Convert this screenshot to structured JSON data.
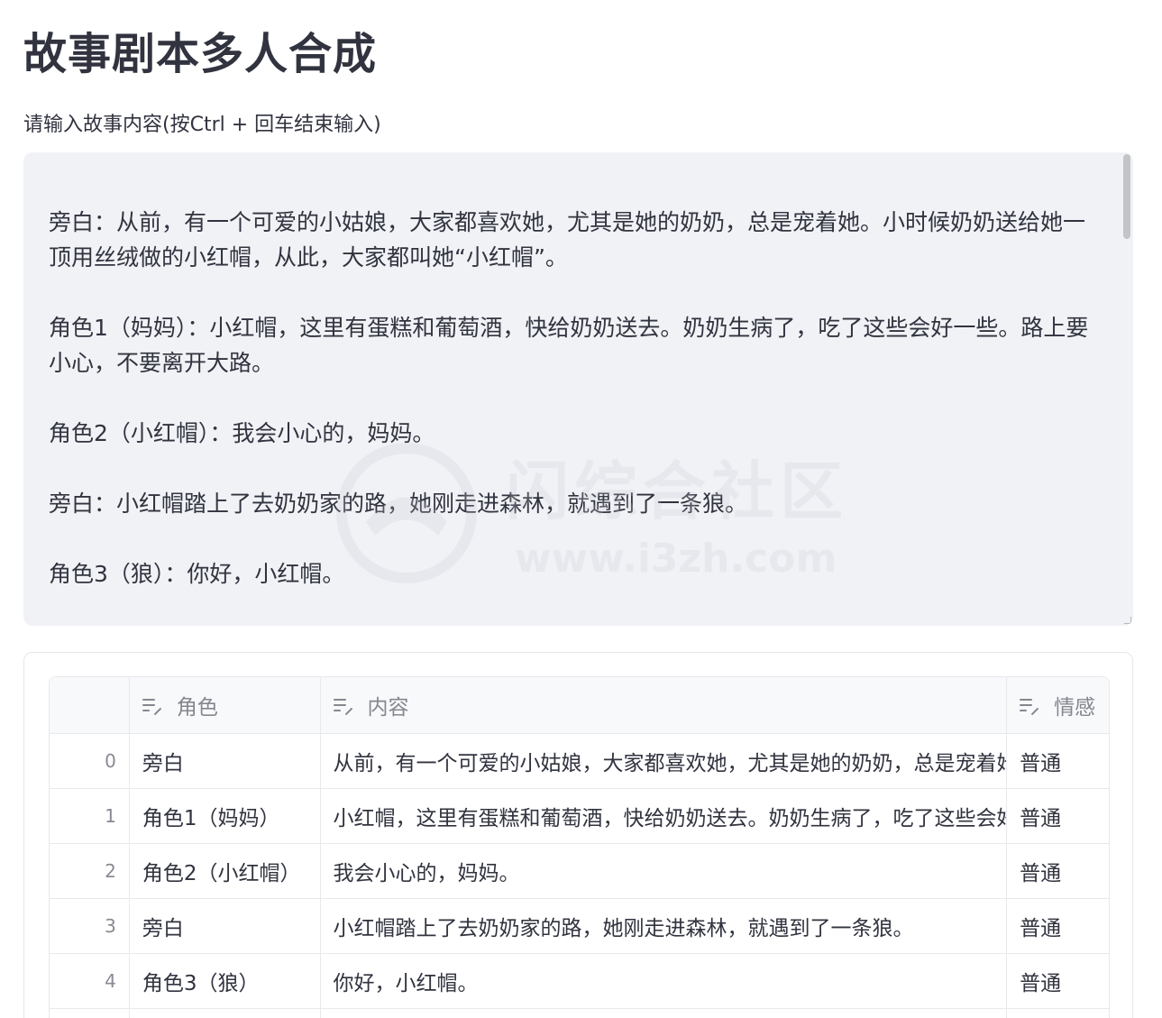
{
  "title": "故事剧本多人合成",
  "story_input": {
    "label": "请输入故事内容(按Ctrl + 回车结束输入)",
    "value": "旁白：从前，有一个可爱的小姑娘，大家都喜欢她，尤其是她的奶奶，总是宠着她。小时候奶奶送给她一顶用丝绒做的小红帽，从此，大家都叫她“小红帽”。\n\n角色1（妈妈）：小红帽，这里有蛋糕和葡萄酒，快给奶奶送去。奶奶生病了，吃了这些会好一些。路上要小心，不要离开大路。\n\n角色2（小红帽）：我会小心的，妈妈。\n\n旁白：小红帽踏上了去奶奶家的路，她刚走进森林，就遇到了一条狼。\n\n角色3（狼）：你好，小红帽。"
  },
  "watermark": {
    "text_cn": "闪综合社区",
    "text_en": "www.i3zh.com"
  },
  "table": {
    "columns": [
      {
        "label": "",
        "icon": ""
      },
      {
        "label": "角色",
        "icon": "text-edit-icon"
      },
      {
        "label": "内容",
        "icon": "text-edit-icon"
      },
      {
        "label": "情感",
        "icon": "text-edit-icon"
      }
    ],
    "rows": [
      {
        "index": "0",
        "role": "旁白",
        "content": "从前，有一个可爱的小姑娘，大家都喜欢她，尤其是她的奶奶，总是宠着她。小时候奶奶送给她一顶用丝绒做的小红帽，从此，大家都叫她“小红帽”。",
        "emotion": "普通"
      },
      {
        "index": "1",
        "role": "角色1（妈妈）",
        "content": "小红帽，这里有蛋糕和葡萄酒，快给奶奶送去。奶奶生病了，吃了这些会好一些。路上要小心，不要离开大路。",
        "emotion": "普通"
      },
      {
        "index": "2",
        "role": "角色2（小红帽）",
        "content": "我会小心的，妈妈。",
        "emotion": "普通"
      },
      {
        "index": "3",
        "role": "旁白",
        "content": "小红帽踏上了去奶奶家的路，她刚走进森林，就遇到了一条狼。",
        "emotion": "普通"
      },
      {
        "index": "4",
        "role": "角色3（狼）",
        "content": "你好，小红帽。",
        "emotion": "普通"
      }
    ]
  }
}
